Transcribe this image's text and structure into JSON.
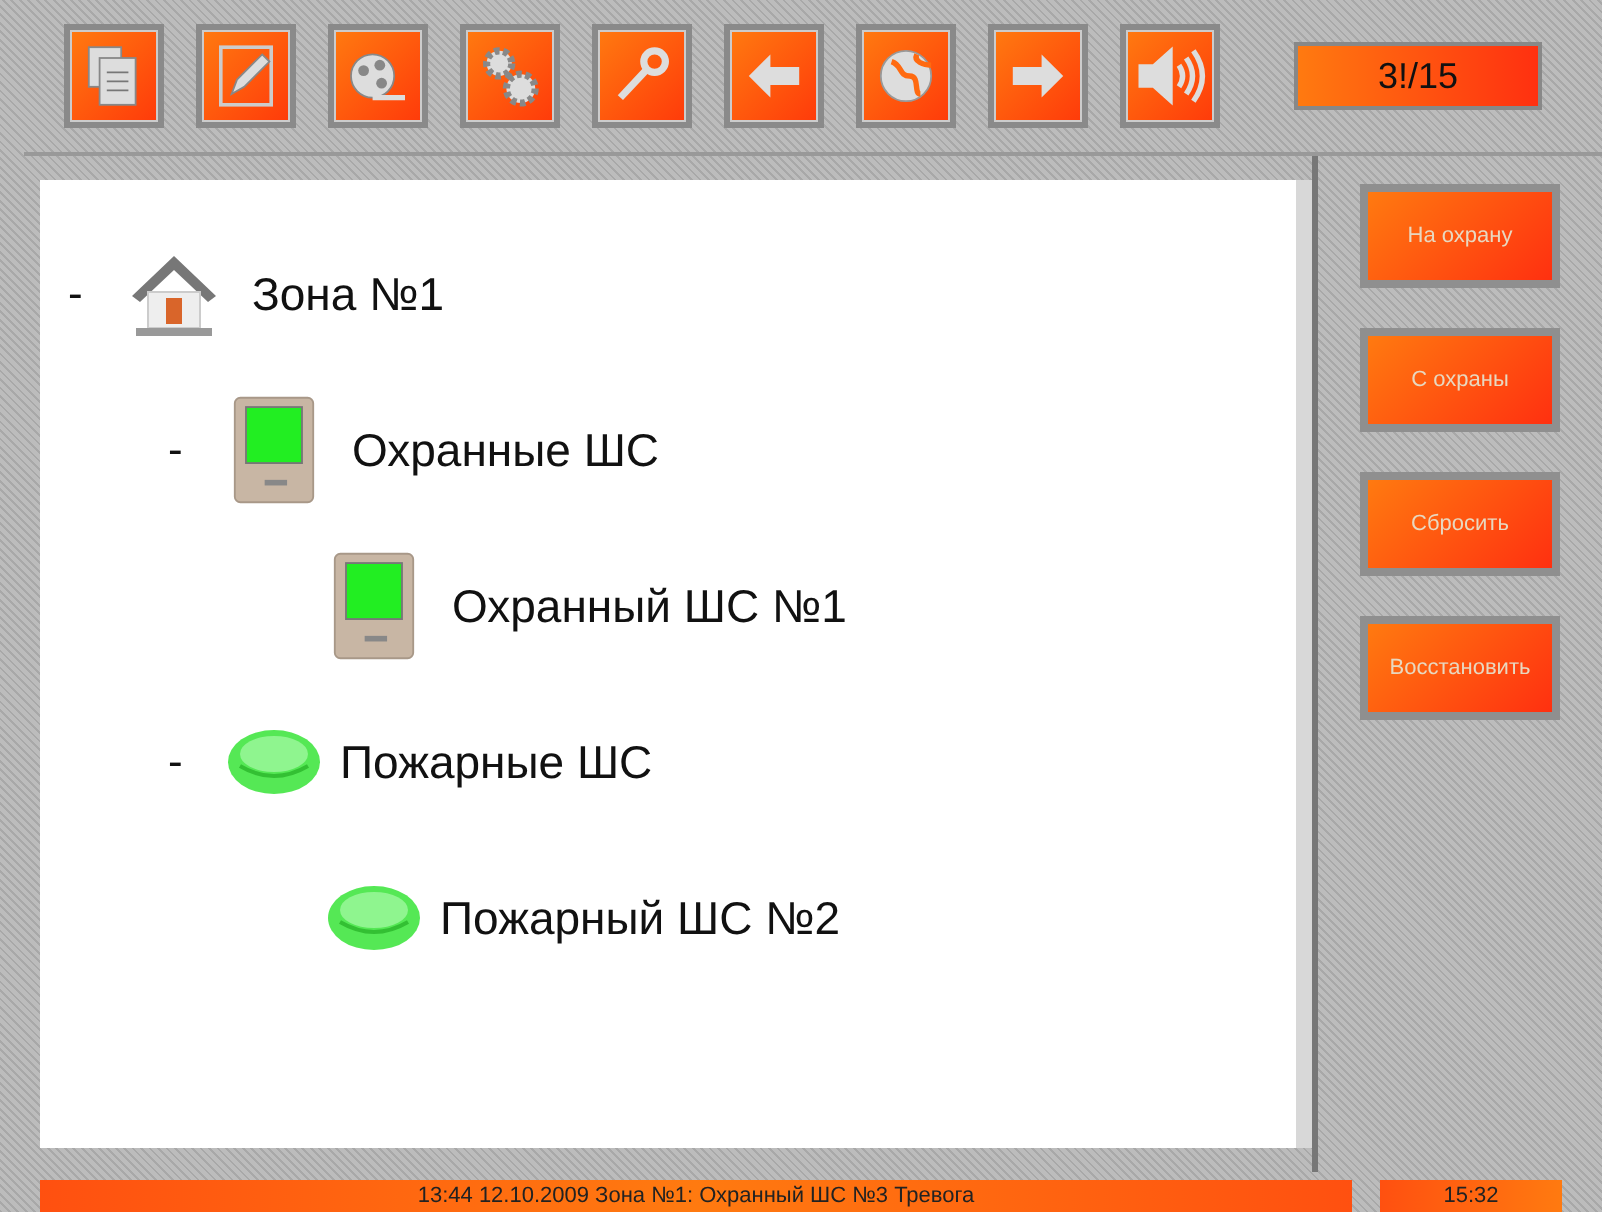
{
  "toolbar": [
    {
      "kind": "document"
    },
    {
      "kind": "pencil"
    },
    {
      "kind": "film"
    },
    {
      "kind": "gears"
    },
    {
      "kind": "key"
    },
    {
      "kind": "back"
    },
    {
      "kind": "globe"
    },
    {
      "kind": "forward"
    },
    {
      "kind": "sound"
    }
  ],
  "counter": "3!/15",
  "tree": [
    {
      "label": "Зона №1",
      "kind": "zone",
      "expander": "-",
      "children": [
        {
          "label": "Охранные ШС",
          "kind": "guard",
          "expander": "-",
          "children": [
            {
              "label": "Охранный ШС №1",
              "kind": "guard"
            }
          ]
        },
        {
          "label": "Пожарные ШС",
          "kind": "fire",
          "expander": "-",
          "children": [
            {
              "label": "Пожарный ШС №2",
              "kind": "fire"
            }
          ]
        }
      ]
    }
  ],
  "actions": [
    "На охрану",
    "С охраны",
    "Сбросить",
    "Восстановить"
  ],
  "status_bar": {
    "message": "13:44 12.10.2009 Зона №1: Охранный ШС №3 Тревога",
    "time": "15:32"
  }
}
